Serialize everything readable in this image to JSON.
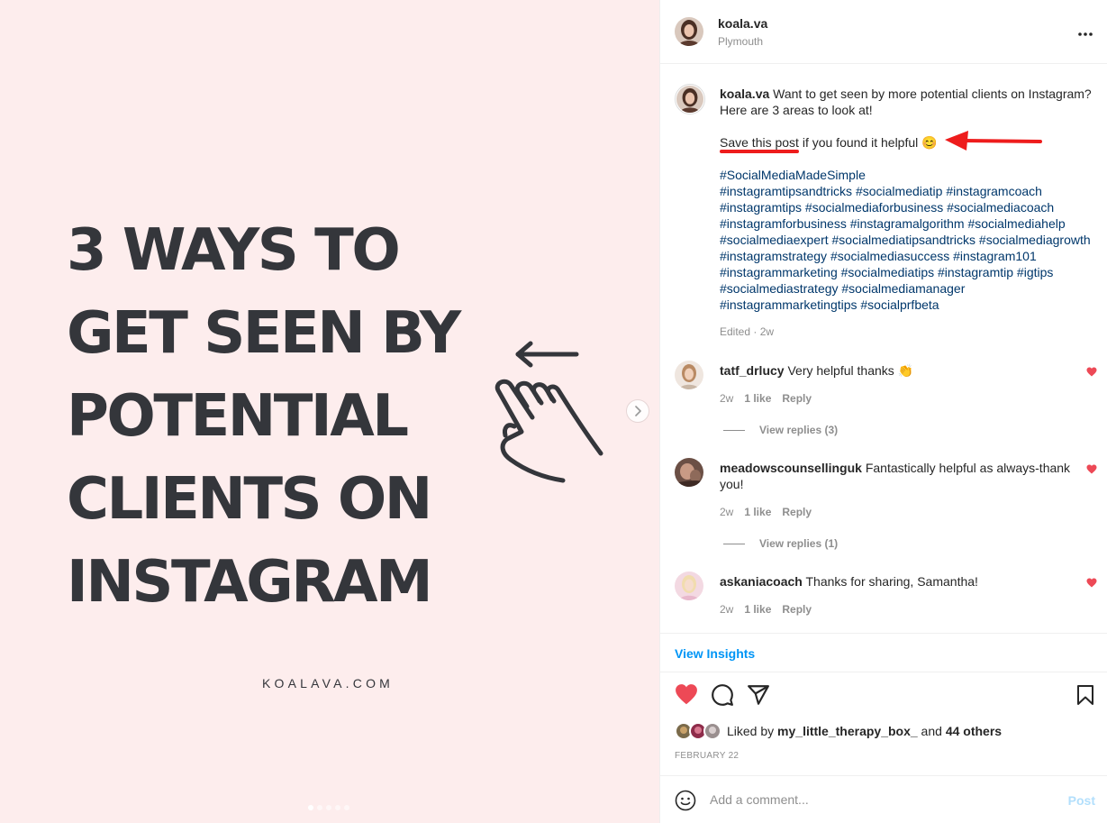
{
  "image": {
    "headline_lines": [
      "3 WAYS TO",
      "GET SEEN BY",
      "POTENTIAL",
      "CLIENTS ON",
      "INSTAGRAM"
    ],
    "brand_url": "KOALAVA.COM",
    "slide_count": 5,
    "active_slide": 1,
    "background_color": "#fdeded",
    "text_color": "#34363b"
  },
  "header": {
    "username": "koala.va",
    "location": "Plymouth"
  },
  "caption": {
    "username": "koala.va",
    "line1": "Want to get seen by more potential clients on Instagram?",
    "line2": "Here are 3 areas to look at!",
    "save_link": "Save this post",
    "save_rest": " if you found it helpful 😊",
    "hashtag_lines": [
      "#SocialMediaMadeSimple",
      "#instagramtipsandtricks #socialmediatip #instagramcoach",
      "#instagramtips #socialmediaforbusiness #socialmediacoach",
      "#instagramforbusiness #instagramalgorithm #socialmediahelp",
      "#socialmediaexpert #socialmediatipsandtricks #socialmediagrowth",
      "#instagramstrategy #socialmediasuccess #instagram101",
      "#instagrammarketing #socialmediatips #instagramtip #igtips",
      "#socialmediastrategy #socialmediamanager",
      "#instagrammarketingtips #socialprfbeta"
    ],
    "edited": "Edited · 2w",
    "annotation_color": "#ee1c1c"
  },
  "comments": [
    {
      "username": "tatf_drlucy",
      "text": "Very helpful thanks 👏",
      "time": "2w",
      "likes": "1 like",
      "reply": "Reply",
      "view_replies": "View replies (3)"
    },
    {
      "username": "meadowscounsellinguk",
      "text": "Fantastically helpful as always-thank you!",
      "time": "2w",
      "likes": "1 like",
      "reply": "Reply",
      "view_replies": "View replies (1)"
    },
    {
      "username": "askaniacoach",
      "text": "Thanks for sharing, Samantha!",
      "time": "2w",
      "likes": "1 like",
      "reply": "Reply"
    }
  ],
  "insights": {
    "label": "View Insights"
  },
  "likes": {
    "prefix": "Liked by ",
    "user": "my_little_therapy_box_",
    "middle": " and ",
    "others": "44 others"
  },
  "post_date": "FEBRUARY 22",
  "comment_box": {
    "placeholder": "Add a comment...",
    "post_label": "Post"
  },
  "colors": {
    "like_red": "#ed4956",
    "link_blue": "#0095f6",
    "hashtag_blue": "#00376b",
    "muted": "#8e8e8e"
  }
}
